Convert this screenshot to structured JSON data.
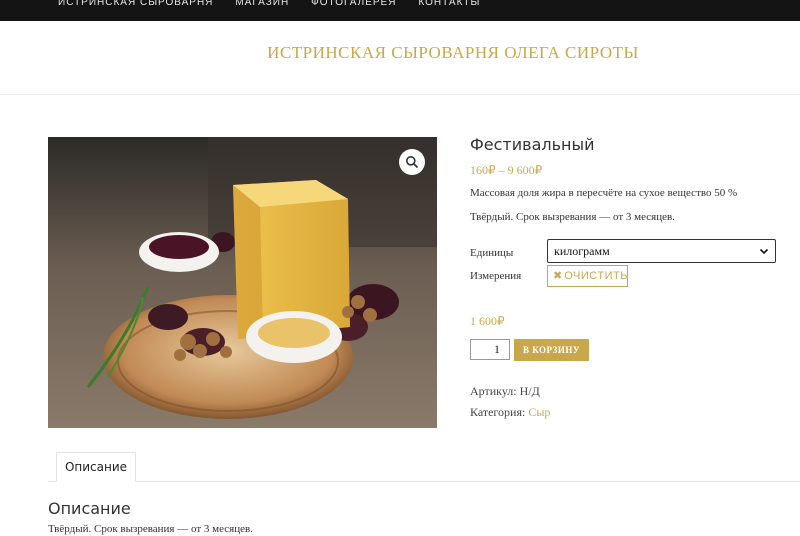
{
  "nav": {
    "items": [
      "ИСТРИНСКАЯ СЫРОВАРНЯ",
      "МАГАЗИН",
      "ФОТОГАЛЕРЕЯ",
      "КОНТАКТЫ"
    ]
  },
  "header": {
    "site_title": "ИСТРИНСКАЯ СЫРОВАРНЯ ОЛЕГА СИРОТЫ"
  },
  "product": {
    "title": "Фестивальный",
    "price_range": "160₽ – 9 600₽",
    "short_description": [
      "Массовая доля жира в пересчёте на сухое вещество 50 %",
      "Твёрдый. Срок вызревания — от 3 месяцев."
    ],
    "variation": {
      "label_line1": "Единицы",
      "label_line2": "Измерения",
      "selected": "килограмм",
      "clear_label": "ОЧИСТИТЬ"
    },
    "variation_price": "1 600₽",
    "quantity": "1",
    "add_to_cart_label": "В КОРЗИНУ",
    "sku_label": "Артикул:",
    "sku_value": "Н/Д",
    "category_label": "Категория:",
    "category_value": "Сыр"
  },
  "tabs": {
    "items": [
      "Описание"
    ]
  },
  "description": {
    "heading": "Описание",
    "text": "Твёрдый. Срок вызревания — от 3 месяцев."
  },
  "colors": {
    "accent": "#c9a84c",
    "topbar": "#141414"
  }
}
